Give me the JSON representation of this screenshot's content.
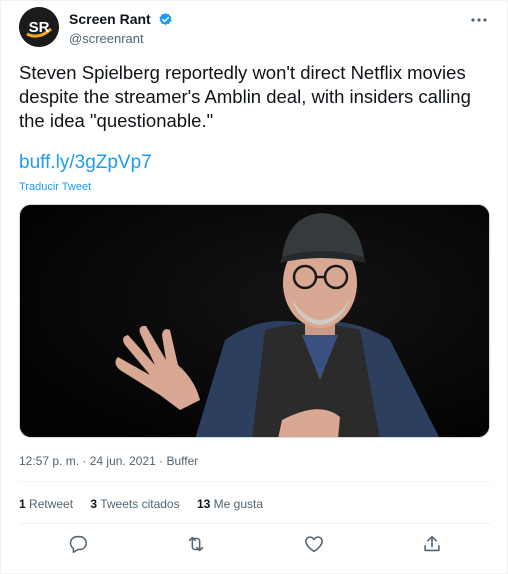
{
  "author": {
    "display_name": "Screen Rant",
    "handle": "@screenrant",
    "logo_text": "SR"
  },
  "tweet": {
    "text": "Steven Spielberg reportedly won't direct Netflix movies despite the streamer's Amblin deal, with insiders calling the idea \"questionable.\"",
    "link": "buff.ly/3gZpVp7",
    "translate_label": "Traducir Tweet"
  },
  "meta": {
    "time": "12:57 p. m.",
    "separator": "·",
    "date": "24 jun. 2021",
    "source": "Buffer"
  },
  "stats": {
    "retweets": {
      "count": "1",
      "label": "Retweet"
    },
    "quotes": {
      "count": "3",
      "label": "Tweets citados"
    },
    "likes": {
      "count": "13",
      "label": "Me gusta"
    }
  },
  "icons": {
    "reply": "reply-icon",
    "retweet": "retweet-icon",
    "like": "heart-icon",
    "share": "share-icon",
    "verified": "verified-badge-icon",
    "more": "more-options-icon"
  },
  "colors": {
    "accent": "#1d9bf0",
    "muted": "#536471",
    "text": "#0f1419",
    "logo_orange": "#f5a623"
  }
}
